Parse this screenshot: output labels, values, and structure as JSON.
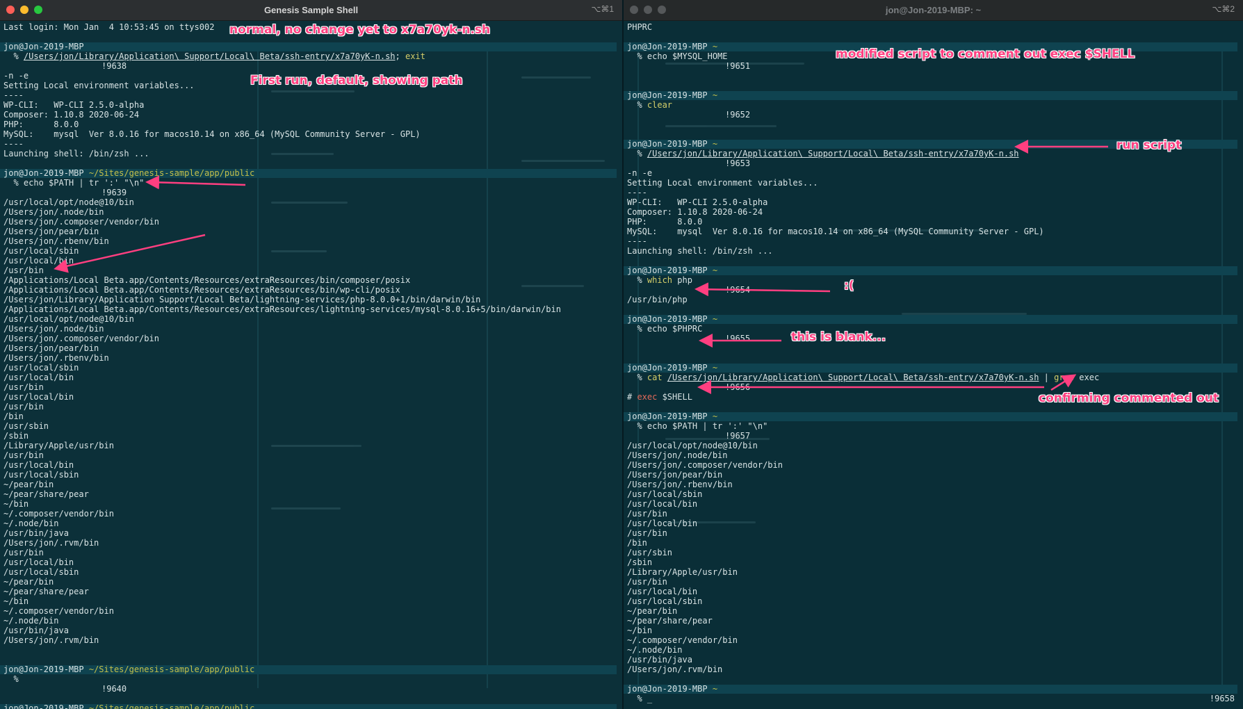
{
  "left_window": {
    "title": "Genesis Sample Shell",
    "shortcut": "⌥⌘1",
    "lines": [
      {
        "t": "text",
        "text": "Last login: Mon Jan  4 10:53:45 on ttys002"
      },
      {
        "t": "blank"
      },
      {
        "t": "prompt",
        "user": "jon@Jon-2019-MBP",
        "path": " "
      },
      {
        "t": "cmd",
        "parts": [
          {
            "text": "  % "
          },
          {
            "text": "/Users/jon/Library/Application\\ Support/Local\\ Beta/ssh-entry/x7a70yK-n.sh",
            "cls": "u"
          },
          {
            "text": "; "
          },
          {
            "text": "exit",
            "cls": "yl"
          }
        ]
      },
      {
        "t": "hist",
        "text": "!9638"
      },
      {
        "t": "text",
        "text": "-n -e"
      },
      {
        "t": "text",
        "text": "Setting Local environment variables..."
      },
      {
        "t": "text",
        "text": "----"
      },
      {
        "t": "text",
        "text": "WP-CLI:   WP-CLI 2.5.0-alpha"
      },
      {
        "t": "text",
        "text": "Composer: 1.10.8 2020-06-24"
      },
      {
        "t": "text",
        "text": "PHP:      8.0.0"
      },
      {
        "t": "text",
        "text": "MySQL:    mysql  Ver 8.0.16 for macos10.14 on x86_64 (MySQL Community Server - GPL)"
      },
      {
        "t": "text",
        "text": "----"
      },
      {
        "t": "text",
        "text": "Launching shell: /bin/zsh ..."
      },
      {
        "t": "blank"
      },
      {
        "t": "prompt",
        "user": "jon@Jon-2019-MBP",
        "path": " ~/Sites/genesis-sample/app/public"
      },
      {
        "t": "cmd",
        "parts": [
          {
            "text": "  % echo $PATH | tr ':' \"\\n\""
          }
        ]
      },
      {
        "t": "hist",
        "text": "!9639"
      },
      {
        "t": "text",
        "text": "/usr/local/opt/node@10/bin"
      },
      {
        "t": "text",
        "text": "/Users/jon/.node/bin"
      },
      {
        "t": "text",
        "text": "/Users/jon/.composer/vendor/bin"
      },
      {
        "t": "text",
        "text": "/Users/jon/pear/bin"
      },
      {
        "t": "text",
        "text": "/Users/jon/.rbenv/bin"
      },
      {
        "t": "text",
        "text": "/usr/local/sbin"
      },
      {
        "t": "text",
        "text": "/usr/local/bin"
      },
      {
        "t": "text",
        "text": "/usr/bin"
      },
      {
        "t": "text",
        "text": "/Applications/Local Beta.app/Contents/Resources/extraResources/bin/composer/posix"
      },
      {
        "t": "text",
        "text": "/Applications/Local Beta.app/Contents/Resources/extraResources/bin/wp-cli/posix"
      },
      {
        "t": "text",
        "text": "/Users/jon/Library/Application Support/Local Beta/lightning-services/php-8.0.0+1/bin/darwin/bin"
      },
      {
        "t": "text",
        "text": "/Applications/Local Beta.app/Contents/Resources/extraResources/lightning-services/mysql-8.0.16+5/bin/darwin/bin"
      },
      {
        "t": "text",
        "text": "/usr/local/opt/node@10/bin"
      },
      {
        "t": "text",
        "text": "/Users/jon/.node/bin"
      },
      {
        "t": "text",
        "text": "/Users/jon/.composer/vendor/bin"
      },
      {
        "t": "text",
        "text": "/Users/jon/pear/bin"
      },
      {
        "t": "text",
        "text": "/Users/jon/.rbenv/bin"
      },
      {
        "t": "text",
        "text": "/usr/local/sbin"
      },
      {
        "t": "text",
        "text": "/usr/local/bin"
      },
      {
        "t": "text",
        "text": "/usr/bin"
      },
      {
        "t": "text",
        "text": "/usr/local/bin"
      },
      {
        "t": "text",
        "text": "/usr/bin"
      },
      {
        "t": "text",
        "text": "/bin"
      },
      {
        "t": "text",
        "text": "/usr/sbin"
      },
      {
        "t": "text",
        "text": "/sbin"
      },
      {
        "t": "text",
        "text": "/Library/Apple/usr/bin"
      },
      {
        "t": "text",
        "text": "/usr/bin"
      },
      {
        "t": "text",
        "text": "/usr/local/bin"
      },
      {
        "t": "text",
        "text": "/usr/local/sbin"
      },
      {
        "t": "text",
        "text": "~/pear/bin"
      },
      {
        "t": "text",
        "text": "~/pear/share/pear"
      },
      {
        "t": "text",
        "text": "~/bin"
      },
      {
        "t": "text",
        "text": "~/.composer/vendor/bin"
      },
      {
        "t": "text",
        "text": "~/.node/bin"
      },
      {
        "t": "text",
        "text": "/usr/bin/java"
      },
      {
        "t": "text",
        "text": "/Users/jon/.rvm/bin"
      },
      {
        "t": "text",
        "text": "/usr/bin"
      },
      {
        "t": "text",
        "text": "/usr/local/bin"
      },
      {
        "t": "text",
        "text": "/usr/local/sbin"
      },
      {
        "t": "text",
        "text": "~/pear/bin"
      },
      {
        "t": "text",
        "text": "~/pear/share/pear"
      },
      {
        "t": "text",
        "text": "~/bin"
      },
      {
        "t": "text",
        "text": "~/.composer/vendor/bin"
      },
      {
        "t": "text",
        "text": "~/.node/bin"
      },
      {
        "t": "text",
        "text": "/usr/bin/java"
      },
      {
        "t": "text",
        "text": "/Users/jon/.rvm/bin"
      },
      {
        "t": "blank"
      },
      {
        "t": "blank"
      },
      {
        "t": "prompt",
        "user": "jon@Jon-2019-MBP",
        "path": " ~/Sites/genesis-sample/app/public"
      },
      {
        "t": "cmd",
        "parts": [
          {
            "text": "  %"
          }
        ]
      },
      {
        "t": "hist",
        "text": "!9640"
      },
      {
        "t": "blank"
      },
      {
        "t": "prompt",
        "user": "jon@Jon-2019-MBP",
        "path": " ~/Sites/genesis-sample/app/public"
      }
    ],
    "annotations": [
      {
        "text": "normal, no change yet to x7a70yk-n.sh"
      },
      {
        "text": "First run, default, showing path"
      }
    ]
  },
  "right_window": {
    "title": "jon@Jon-2019-MBP: ~",
    "shortcut": "⌥⌘2",
    "lines": [
      {
        "t": "text",
        "text": "PHPRC"
      },
      {
        "t": "blank"
      },
      {
        "t": "prompt",
        "user": "jon@Jon-2019-MBP",
        "path": " ~"
      },
      {
        "t": "cmd",
        "parts": [
          {
            "text": "  % echo $MYSQL_HOME"
          }
        ]
      },
      {
        "t": "hist",
        "text": "!9651"
      },
      {
        "t": "blank"
      },
      {
        "t": "blank"
      },
      {
        "t": "prompt",
        "user": "jon@Jon-2019-MBP",
        "path": " ~"
      },
      {
        "t": "cmd",
        "parts": [
          {
            "text": "  % "
          },
          {
            "text": "clear",
            "cls": "yl"
          }
        ]
      },
      {
        "t": "hist",
        "text": "!9652"
      },
      {
        "t": "blank"
      },
      {
        "t": "blank"
      },
      {
        "t": "prompt",
        "user": "jon@Jon-2019-MBP",
        "path": " ~"
      },
      {
        "t": "cmd",
        "parts": [
          {
            "text": "  % "
          },
          {
            "text": "/Users/jon/Library/Application\\ Support/Local\\ Beta/ssh-entry/x7a70yK-n.sh",
            "cls": "u"
          }
        ]
      },
      {
        "t": "hist",
        "text": "!9653"
      },
      {
        "t": "text",
        "text": "-n -e"
      },
      {
        "t": "text",
        "text": "Setting Local environment variables..."
      },
      {
        "t": "text",
        "text": "----"
      },
      {
        "t": "text",
        "text": "WP-CLI:   WP-CLI 2.5.0-alpha"
      },
      {
        "t": "text",
        "text": "Composer: 1.10.8 2020-06-24"
      },
      {
        "t": "text",
        "text": "PHP:      8.0.0"
      },
      {
        "t": "text",
        "text": "MySQL:    mysql  Ver 8.0.16 for macos10.14 on x86_64 (MySQL Community Server - GPL)"
      },
      {
        "t": "text",
        "text": "----"
      },
      {
        "t": "text",
        "text": "Launching shell: /bin/zsh ..."
      },
      {
        "t": "blank"
      },
      {
        "t": "prompt",
        "user": "jon@Jon-2019-MBP",
        "path": " ~"
      },
      {
        "t": "cmd",
        "parts": [
          {
            "text": "  % "
          },
          {
            "text": "which",
            "cls": "yl"
          },
          {
            "text": " php"
          }
        ]
      },
      {
        "t": "hist",
        "text": "!9654"
      },
      {
        "t": "text",
        "text": "/usr/bin/php"
      },
      {
        "t": "blank"
      },
      {
        "t": "prompt",
        "user": "jon@Jon-2019-MBP",
        "path": " ~"
      },
      {
        "t": "cmd",
        "parts": [
          {
            "text": "  % echo $PHPRC"
          }
        ]
      },
      {
        "t": "hist",
        "text": "!9655"
      },
      {
        "t": "blank"
      },
      {
        "t": "blank"
      },
      {
        "t": "prompt",
        "user": "jon@Jon-2019-MBP",
        "path": " ~"
      },
      {
        "t": "cmd",
        "parts": [
          {
            "text": "  % "
          },
          {
            "text": "cat",
            "cls": "yl"
          },
          {
            "text": " "
          },
          {
            "text": "/Users/jon/Library/Application\\ Support/Local\\ Beta/ssh-entry/x7a70yK-n.sh",
            "cls": "u"
          },
          {
            "text": " | "
          },
          {
            "text": "grep",
            "cls": "yl"
          },
          {
            "text": " exec"
          }
        ]
      },
      {
        "t": "hist",
        "text": "!9656"
      },
      {
        "t": "cmd",
        "parts": [
          {
            "text": "# "
          },
          {
            "text": "exec",
            "cls": "rd"
          },
          {
            "text": " $SHELL"
          }
        ]
      },
      {
        "t": "blank"
      },
      {
        "t": "prompt",
        "user": "jon@Jon-2019-MBP",
        "path": " ~"
      },
      {
        "t": "cmd",
        "parts": [
          {
            "text": "  % echo $PATH | tr ':' \"\\n\""
          }
        ]
      },
      {
        "t": "hist",
        "text": "!9657"
      },
      {
        "t": "text",
        "text": "/usr/local/opt/node@10/bin"
      },
      {
        "t": "text",
        "text": "/Users/jon/.node/bin"
      },
      {
        "t": "text",
        "text": "/Users/jon/.composer/vendor/bin"
      },
      {
        "t": "text",
        "text": "/Users/jon/pear/bin"
      },
      {
        "t": "text",
        "text": "/Users/jon/.rbenv/bin"
      },
      {
        "t": "text",
        "text": "/usr/local/sbin"
      },
      {
        "t": "text",
        "text": "/usr/local/bin"
      },
      {
        "t": "text",
        "text": "/usr/bin"
      },
      {
        "t": "text",
        "text": "/usr/local/bin"
      },
      {
        "t": "text",
        "text": "/usr/bin"
      },
      {
        "t": "text",
        "text": "/bin"
      },
      {
        "t": "text",
        "text": "/usr/sbin"
      },
      {
        "t": "text",
        "text": "/sbin"
      },
      {
        "t": "text",
        "text": "/Library/Apple/usr/bin"
      },
      {
        "t": "text",
        "text": "/usr/bin"
      },
      {
        "t": "text",
        "text": "/usr/local/bin"
      },
      {
        "t": "text",
        "text": "/usr/local/sbin"
      },
      {
        "t": "text",
        "text": "~/pear/bin"
      },
      {
        "t": "text",
        "text": "~/pear/share/pear"
      },
      {
        "t": "text",
        "text": "~/bin"
      },
      {
        "t": "text",
        "text": "~/.composer/vendor/bin"
      },
      {
        "t": "text",
        "text": "~/.node/bin"
      },
      {
        "t": "text",
        "text": "/usr/bin/java"
      },
      {
        "t": "text",
        "text": "/Users/jon/.rvm/bin"
      },
      {
        "t": "blank"
      },
      {
        "t": "prompt",
        "user": "jon@Jon-2019-MBP",
        "path": " ~"
      },
      {
        "t": "cmd",
        "parts": [
          {
            "text": "  % _"
          }
        ],
        "right": "!9658"
      }
    ],
    "annotations": [
      {
        "text": "modified script to comment out exec $SHELL"
      },
      {
        "text": "run script"
      },
      {
        "text": ":("
      },
      {
        "text": "this is blank..."
      },
      {
        "text": "confirming commented out"
      }
    ]
  },
  "colors": {
    "annotation": "#ff3f80",
    "prompt_bar": "#0f4350",
    "path": "#c4c04a",
    "close": "#ff5f57",
    "minimize": "#febc2e",
    "maximize": "#28c840"
  },
  "icons": [
    "close-button",
    "minimize-button",
    "zoom-button",
    "arrow"
  ]
}
